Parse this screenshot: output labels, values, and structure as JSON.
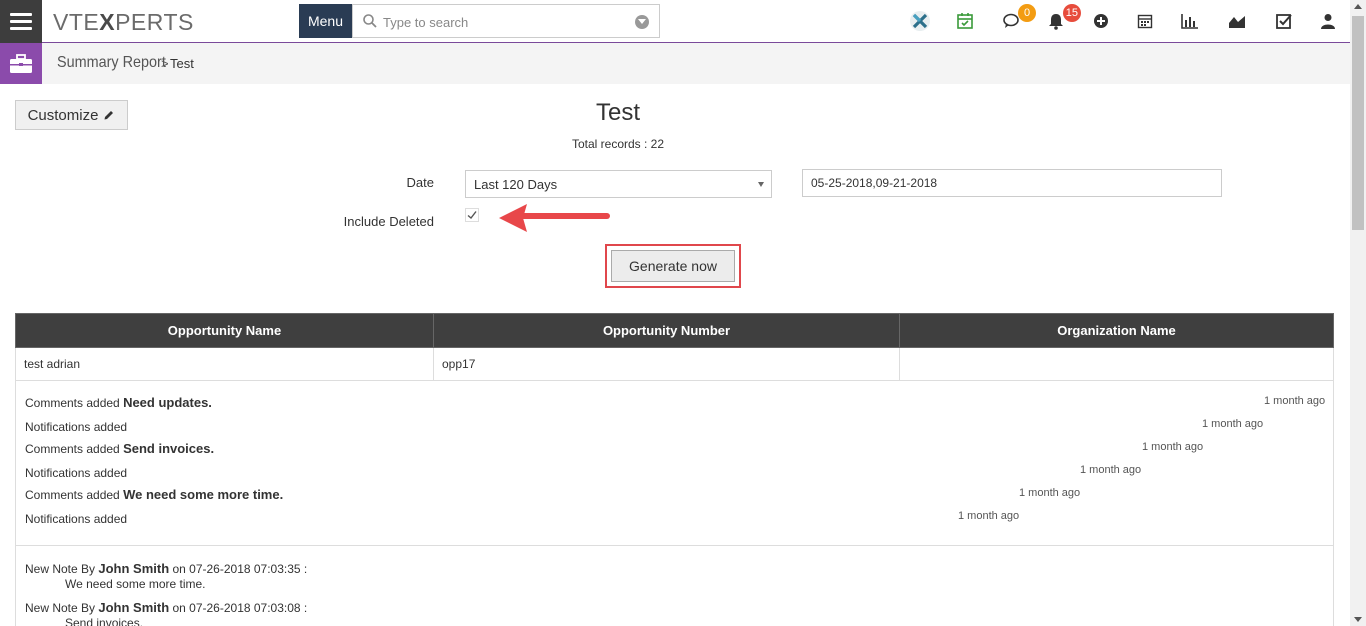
{
  "header": {
    "logo_left": "VTE",
    "logo_x": "X",
    "logo_right": "PERTS",
    "menu_label": "Menu",
    "search_placeholder": "Type to search",
    "chat_badge": "0",
    "notif_badge": "15",
    "colors": {
      "menu_bg": "#2a3c54",
      "accent": "#8b4bab",
      "badge_orange": "#f39c12",
      "badge_red": "#e74c3c"
    }
  },
  "breadcrumb": {
    "main": "Summary Report",
    "separator": ">",
    "current": "Test"
  },
  "report": {
    "customize_label": "Customize",
    "title": "Test",
    "total_records": "Total records : 22",
    "date_label": "Date",
    "date_option": "Last 120 Days",
    "date_range": "05-25-2018,09-21-2018",
    "include_deleted_label": "Include Deleted",
    "generate_label": "Generate now"
  },
  "table": {
    "headers": [
      "Opportunity Name",
      "Opportunity Number",
      "Organization Name"
    ],
    "rows": [
      [
        "test adrian",
        "opp17",
        ""
      ]
    ]
  },
  "activities": [
    {
      "prefix": "Comments added ",
      "bold": "Need updates.",
      "time": "1 month ago"
    },
    {
      "prefix": "Notifications added",
      "bold": "",
      "time": "1 month ago"
    },
    {
      "prefix": "Comments added ",
      "bold": "Send invoices.",
      "time": "1 month ago"
    },
    {
      "prefix": "Notifications added",
      "bold": "",
      "time": "1 month ago"
    },
    {
      "prefix": "Comments added ",
      "bold": "We need some more time.",
      "time": "1 month ago"
    },
    {
      "prefix": "Notifications added",
      "bold": "",
      "time": "1 month ago"
    }
  ],
  "notes": [
    {
      "prefix": "New Note By ",
      "author": "John Smith",
      "suffix": " on 07-26-2018 07:03:35 :",
      "body": "We need some more time."
    },
    {
      "prefix": "New Note By ",
      "author": "John Smith",
      "suffix": " on 07-26-2018 07:03:08 :",
      "body": "Send invoices."
    }
  ]
}
